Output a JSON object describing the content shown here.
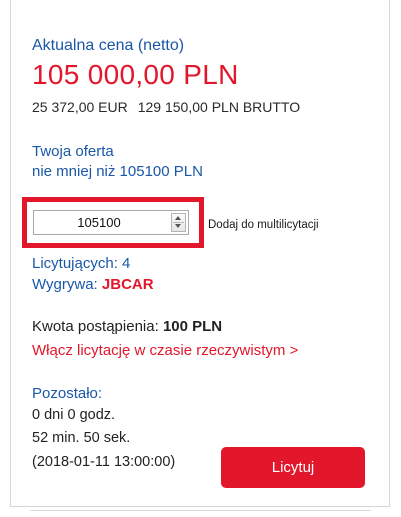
{
  "price_section": {
    "label": "Aktualna cena (netto)",
    "price": "105 000,00 PLN",
    "price_eur": "25 372,00 EUR",
    "price_gross": "129 150,00 PLN BRUTTO"
  },
  "offer": {
    "label": "Twoja oferta",
    "minimum": "nie mniej niż 105100 PLN",
    "input_value": "105100",
    "multi_label": "Dodaj do multilicytacji"
  },
  "status": {
    "bidders": "Licytujących: 4",
    "winning_label": "Wygrywa:",
    "winning_user": "JBCAR"
  },
  "increment": {
    "label": "Kwota postąpienia:",
    "value": "100 PLN",
    "realtime_link": "Włącz licytację w czasie rzeczywistym >"
  },
  "remaining": {
    "label": "Pozostało:",
    "days_hours": "0 dni 0 godz.",
    "min_sec": "52 min. 50 sek.",
    "end_date": "(2018-01-11 13:00:00)"
  },
  "bid_button": {
    "label": "Licytuj"
  },
  "colors": {
    "accent_red": "#e2172b",
    "link_blue": "#1a57a8"
  }
}
